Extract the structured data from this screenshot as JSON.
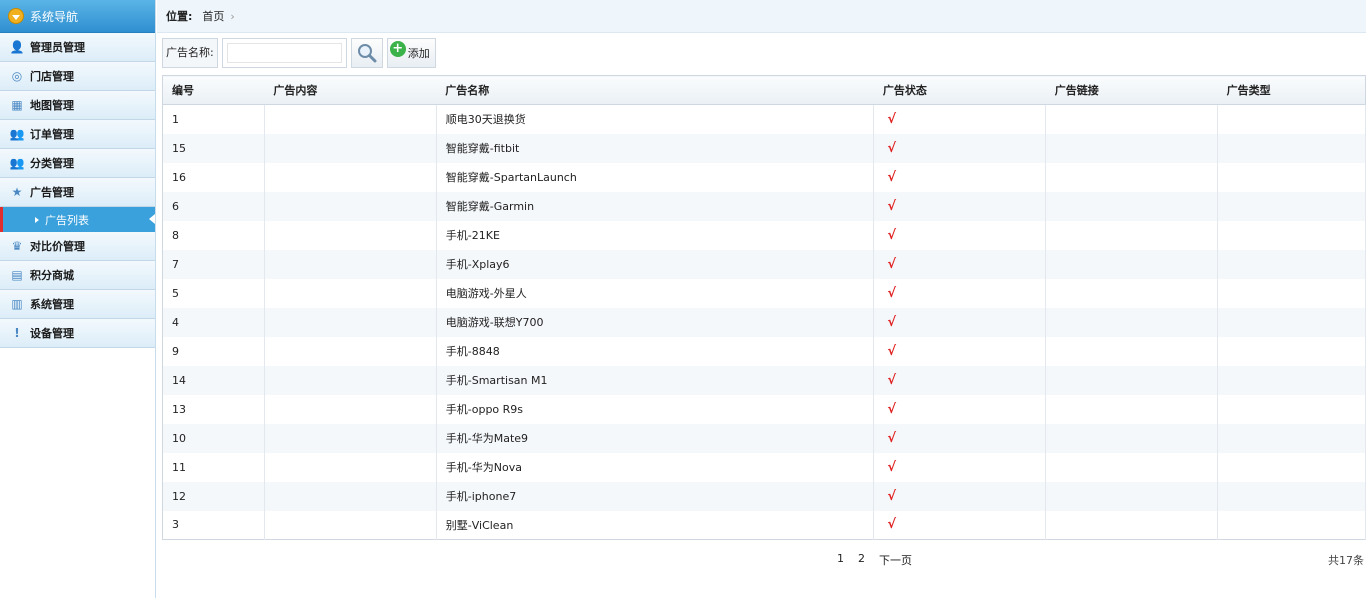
{
  "sidebar": {
    "header": "系统导航",
    "items": [
      {
        "label": "管理员管理",
        "icon": "user-add-icon"
      },
      {
        "label": "门店管理",
        "icon": "globe-icon"
      },
      {
        "label": "地图管理",
        "icon": "map-icon"
      },
      {
        "label": "订单管理",
        "icon": "users-icon"
      },
      {
        "label": "分类管理",
        "icon": "users-icon"
      },
      {
        "label": "广告管理",
        "icon": "star-icon"
      }
    ],
    "active_sub": "广告列表",
    "items_after": [
      {
        "label": "对比价管理",
        "icon": "crown-icon"
      },
      {
        "label": "积分商城",
        "icon": "chart-icon"
      },
      {
        "label": "系统管理",
        "icon": "document-icon"
      },
      {
        "label": "设备管理",
        "icon": "exclamation-icon"
      }
    ]
  },
  "breadcrumb": {
    "label": "位置:",
    "home": "首页",
    "sep": "›"
  },
  "toolbar": {
    "search_label": "广告名称:",
    "search_value": "",
    "add_label": "添加"
  },
  "table": {
    "headers": [
      "编号",
      "广告内容",
      "广告名称",
      "广告状态",
      "广告链接",
      "广告类型"
    ],
    "status_mark": "√",
    "rows": [
      {
        "id": "1",
        "content": "",
        "name": "顺电30天退换货"
      },
      {
        "id": "15",
        "content": "",
        "name": "智能穿戴-fitbit"
      },
      {
        "id": "16",
        "content": "",
        "name": "智能穿戴-SpartanLaunch"
      },
      {
        "id": "6",
        "content": "",
        "name": "智能穿戴-Garmin"
      },
      {
        "id": "8",
        "content": "",
        "name": "手机-21KE"
      },
      {
        "id": "7",
        "content": "",
        "name": "手机-Xplay6"
      },
      {
        "id": "5",
        "content": "",
        "name": "电脑游戏-外星人"
      },
      {
        "id": "4",
        "content": "",
        "name": "电脑游戏-联想Y700"
      },
      {
        "id": "9",
        "content": "",
        "name": "手机-8848"
      },
      {
        "id": "14",
        "content": "",
        "name": "手机-Smartisan M1"
      },
      {
        "id": "13",
        "content": "",
        "name": "手机-oppo R9s"
      },
      {
        "id": "10",
        "content": "",
        "name": "手机-华为Mate9"
      },
      {
        "id": "11",
        "content": "",
        "name": "手机-华为Nova"
      },
      {
        "id": "12",
        "content": "",
        "name": "手机-iphone7"
      },
      {
        "id": "3",
        "content": "",
        "name": "别墅-ViClean"
      }
    ]
  },
  "pager": {
    "pages": [
      "1",
      "2"
    ],
    "next": "下一页",
    "total": "共17条"
  },
  "colors": {
    "accent": "#3aa1dc",
    "check": "#e02020"
  }
}
